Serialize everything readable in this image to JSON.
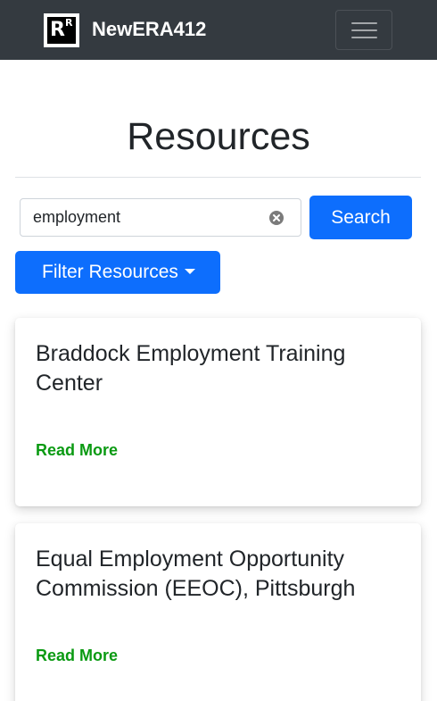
{
  "navbar": {
    "brand_name": "NewERA412",
    "logo_letters": "R",
    "logo_small": "R"
  },
  "main": {
    "title": "Resources",
    "search": {
      "value": "employment"
    },
    "search_button_label": "Search",
    "filter_button_label": "Filter Resources"
  },
  "results": [
    {
      "title": "Braddock Employment Training Center",
      "link_label": "Read More"
    },
    {
      "title": "Equal Employment Opportunity Commission (EEOC), Pittsburgh",
      "link_label": "Read More"
    }
  ],
  "colors": {
    "navbar": "#343a40",
    "primary": "#0d6efd",
    "link": "#0a9a12"
  },
  "icons": {
    "menu": "hamburger-icon",
    "clear": "clear-icon",
    "dropdown": "caret-down-icon"
  }
}
